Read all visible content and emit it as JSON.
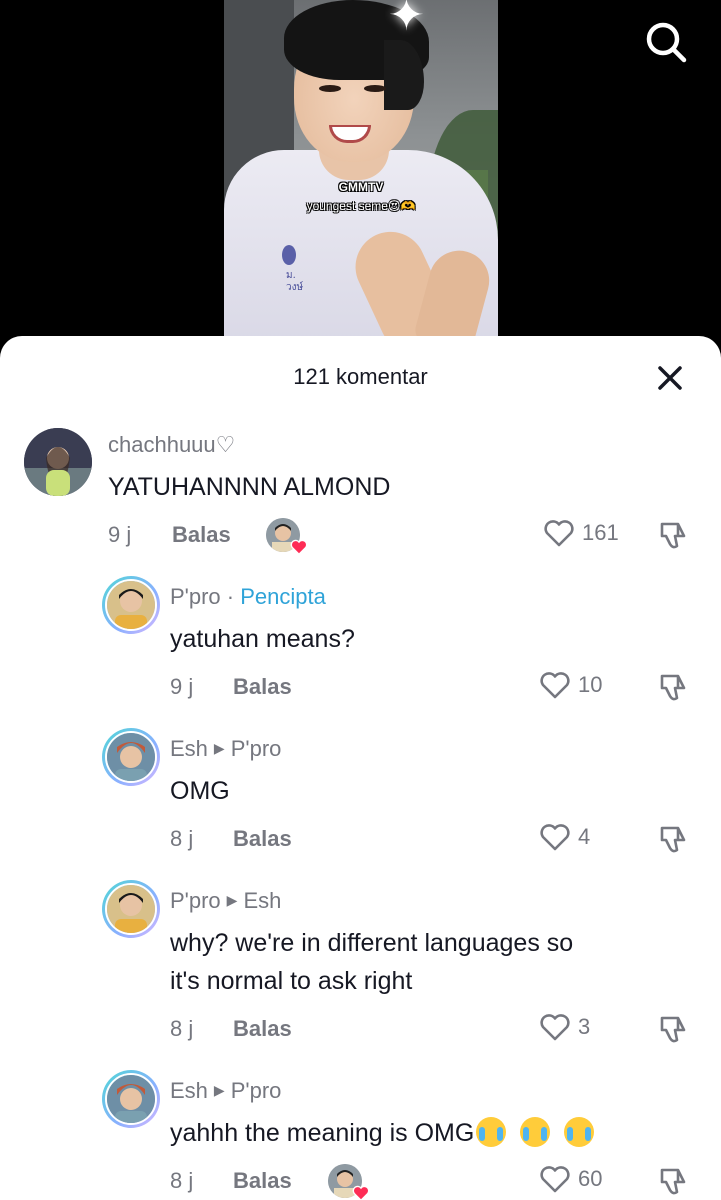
{
  "video": {
    "caption_line1": "GMMTV",
    "caption_line2": "youngest seme😍🫶",
    "shirt_text": "ม.\nวงษ์"
  },
  "icons": {
    "search": "search-icon",
    "close": "close-icon",
    "like": "heart-outline-icon",
    "dislike": "thumbs-down-icon"
  },
  "colors": {
    "creator_label": "#2fa3d8",
    "muted_text": "#75777f",
    "primary_text": "#161823"
  },
  "sheet": {
    "title": "121 komentar"
  },
  "comments": [
    {
      "username": "chachhuuu♡",
      "text": "YATUHANNNN ALMOND",
      "time": "9 j",
      "reply_label": "Balas",
      "likes": "161",
      "creator_liked": true
    },
    {
      "username": "P'pro",
      "separator": " · ",
      "creator_label": "Pencipta",
      "text": "yatuhan means?",
      "time": "9 j",
      "reply_label": "Balas",
      "likes": "10"
    },
    {
      "username": "Esh",
      "reply_to": "P'pro",
      "text": "OMG",
      "time": "8 j",
      "reply_label": "Balas",
      "likes": "4"
    },
    {
      "username": "P'pro",
      "reply_to": "Esh",
      "text_line1": "why? we're in different languages so",
      "text_line2": "it's normal to ask right",
      "time": "8 j",
      "reply_label": "Balas",
      "likes": "3"
    },
    {
      "username": "Esh",
      "reply_to": "P'pro",
      "text": "yahhh the meaning is OMG",
      "time": "8 j",
      "reply_label": "Balas",
      "likes": "60",
      "creator_liked": true
    }
  ]
}
